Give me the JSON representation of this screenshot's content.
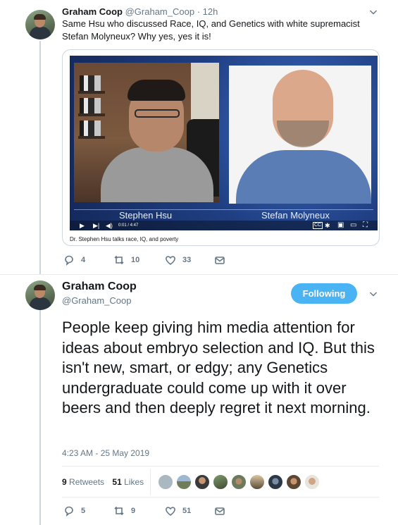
{
  "tweet1": {
    "name": "Graham Coop",
    "handle": "@Graham_Coop",
    "time": "· 12h",
    "text": "Same Hsu who discussed Race, IQ, and Genetics with white supremacist Stefan Molyneux? Why yes, yes it is!",
    "media": {
      "left_caption": "Stephen Hsu",
      "right_caption": "Stefan Molyneux",
      "timecode": "0:01 / 4:47",
      "card_caption": "Dr. Stephen Hsu talks race, IQ, and poverty"
    },
    "actions": {
      "replies": "4",
      "retweets": "10",
      "likes": "33"
    }
  },
  "tweet2": {
    "name": "Graham Coop",
    "handle": "@Graham_Coop",
    "follow_label": "Following",
    "text": "People keep giving him media attention for ideas about embryo selection and IQ. But this isn't new, smart, or edgy; any Genetics undergraduate could come up with it over beers and then deeply regret it next morning.",
    "timestamp": "4:23 AM - 25 May 2019",
    "stats": {
      "retweets_count": "9",
      "retweets_label": "Retweets",
      "likes_count": "51",
      "likes_label": "Likes"
    },
    "actions": {
      "replies": "5",
      "retweets": "9",
      "likes": "51"
    }
  },
  "colors": {
    "accent": "#4ab3f4",
    "secondary_text": "#657786",
    "thread_line": "#ccd6dd"
  },
  "icons": [
    "reply-icon",
    "retweet-icon",
    "like-icon",
    "dm-icon",
    "chevron-down-icon",
    "play-icon",
    "next-icon",
    "volume-icon",
    "cc-icon",
    "settings-icon",
    "miniplayer-icon",
    "theater-icon",
    "fullscreen-icon"
  ]
}
